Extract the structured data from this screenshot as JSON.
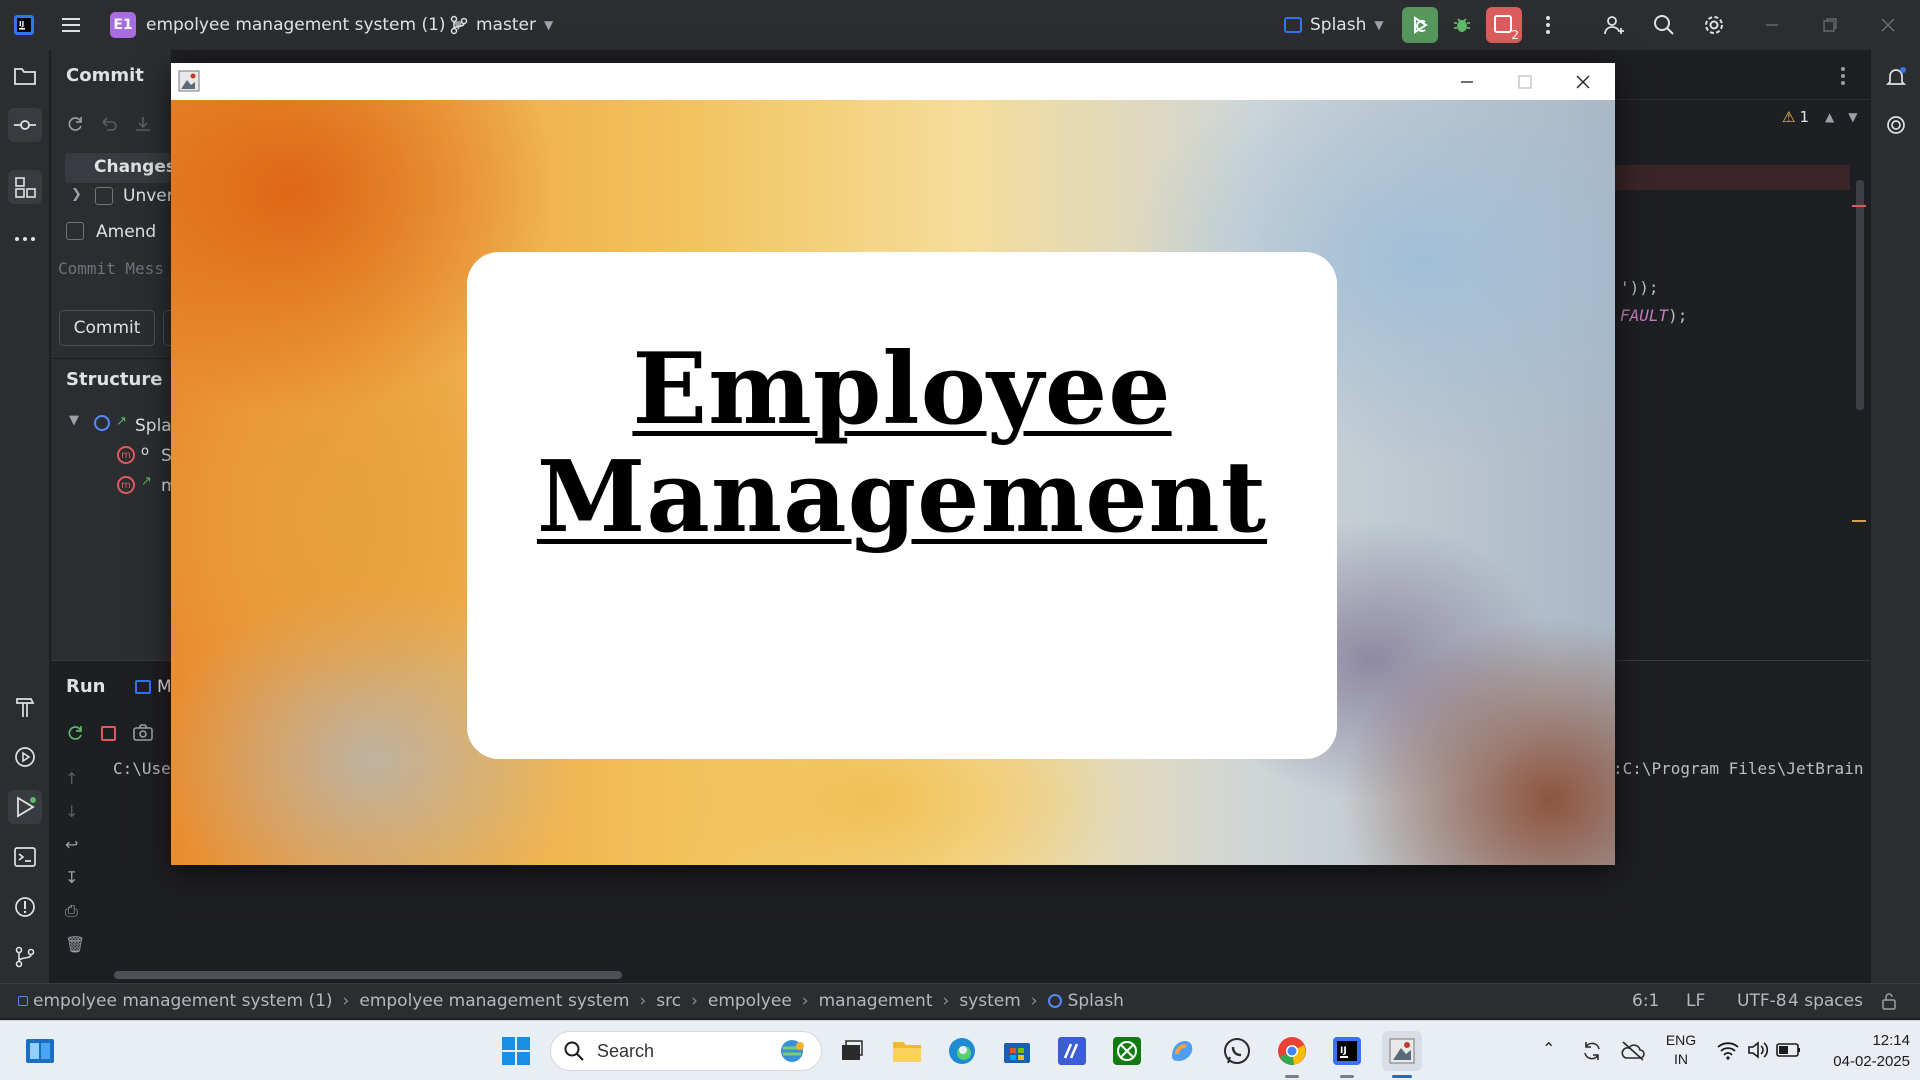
{
  "titlebar": {
    "project_badge": "E1",
    "project_name": "empolyee management system (1)",
    "branch": "master",
    "run_config": "Splash",
    "vcs_badge_count": "2"
  },
  "commit_panel": {
    "title": "Commit",
    "changes_tab": "Changes",
    "unversioned": "Unver",
    "amend": "Amend",
    "commit_message_placeholder": "Commit Mess",
    "commit_button": "Commit"
  },
  "structure_panel": {
    "title": "Structure",
    "root_item": "Spla",
    "item1": "S",
    "item2": "m"
  },
  "editor": {
    "warnings": "1",
    "code_line1": "'));",
    "code_line2_italic": "FAULT",
    "code_line2_end": ");"
  },
  "run_panel": {
    "title": "Run",
    "tab": "M",
    "console_left": "C:\\Use",
    "console_right": ":C:\\Program Files\\JetBrain"
  },
  "statusbar": {
    "crumbs": [
      "empolyee management system (1)",
      "empolyee management system",
      "src",
      "empolyee",
      "management",
      "system",
      "Splash"
    ],
    "position": "6:1",
    "line_sep": "LF",
    "encoding": "UTF-8",
    "indent": "4 spaces"
  },
  "splash": {
    "title_line1": "Employee",
    "title_line2": "Management"
  },
  "taskbar": {
    "search_placeholder": "Search",
    "lang_top": "ENG",
    "lang_bottom": "IN",
    "time": "12:14",
    "date": "04-02-2025"
  }
}
